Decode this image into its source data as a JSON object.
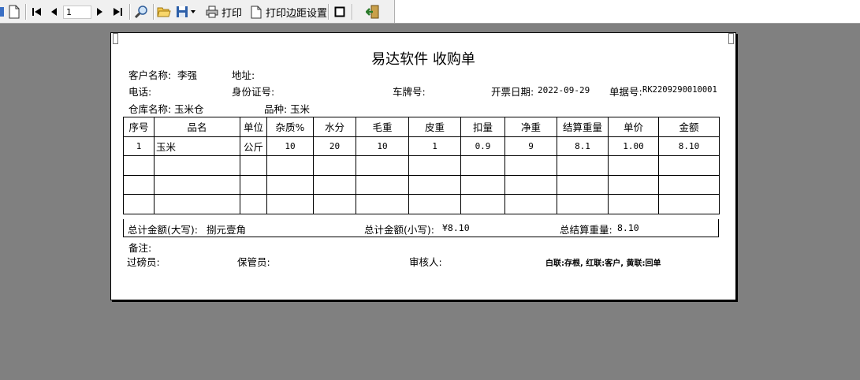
{
  "toolbar": {
    "page_number": "1",
    "print_label": "打印",
    "print_margin_label": "打印边距设置"
  },
  "document": {
    "title": "易达软件  收购单",
    "customer_label": "客户名称:",
    "customer_value": "李强",
    "address_label": "地址:",
    "phone_label": "电话:",
    "id_label": "身份证号:",
    "plate_label": "车牌号:",
    "date_label": "开票日期:",
    "date_value": "2022-09-29",
    "bill_label": "单据号:",
    "bill_value": "RK2209290010001",
    "warehouse_label": "仓库名称:",
    "warehouse_value": "玉米仓",
    "variety_label": "品种:",
    "variety_value": "玉米",
    "table": {
      "headers": [
        "序号",
        "品名",
        "单位",
        "杂质%",
        "水分",
        "毛重",
        "皮重",
        "扣量",
        "净重",
        "结算重量",
        "单价",
        "金额"
      ],
      "rows": [
        [
          "1",
          "玉米",
          "公斤",
          "10",
          "20",
          "10",
          "1",
          "0.9",
          "9",
          "8.1",
          "1.00",
          "8.10"
        ],
        [
          "",
          "",
          "",
          "",
          "",
          "",
          "",
          "",
          "",
          "",
          "",
          ""
        ],
        [
          "",
          "",
          "",
          "",
          "",
          "",
          "",
          "",
          "",
          "",
          "",
          ""
        ],
        [
          "",
          "",
          "",
          "",
          "",
          "",
          "",
          "",
          "",
          "",
          "",
          ""
        ]
      ]
    },
    "total_upper_label": "总计金额(大写):",
    "total_upper_value": "捌元壹角",
    "total_lower_label": "总计金额(小写):",
    "total_lower_value": "¥8.10",
    "total_weight_label": "总结算重量:",
    "total_weight_value": "8.10",
    "remark_label": "备注:",
    "weigher_label": "过磅员:",
    "keeper_label": "保管员:",
    "auditor_label": "审核人:",
    "copies_note": "白联:存根, 红联:客户, 黄联:回单"
  }
}
